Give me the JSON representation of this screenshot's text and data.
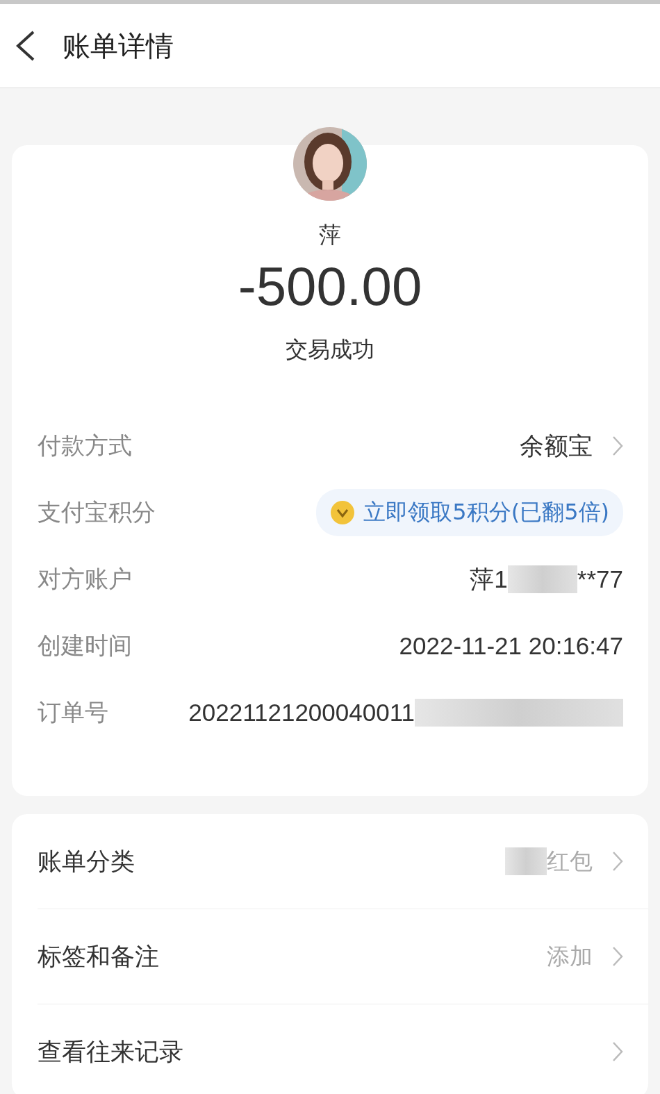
{
  "header": {
    "title": "账单详情"
  },
  "summary": {
    "name": "萍",
    "amount": "-500.00",
    "status": "交易成功"
  },
  "details": [
    {
      "kind": "link",
      "label": "付款方式",
      "value": "余额宝"
    },
    {
      "kind": "points",
      "label": "支付宝积分",
      "value": "立即领取5积分(已翻5倍)"
    },
    {
      "kind": "masked",
      "label": "对方账户",
      "value": "萍1",
      "tail": "**77"
    },
    {
      "kind": "plain",
      "label": "创建时间",
      "value": "2022-11-21 20:16:47"
    },
    {
      "kind": "masked",
      "label": "订单号",
      "value": "20221121200040011"
    }
  ],
  "actions": [
    {
      "label": "账单分类",
      "value": "红包",
      "masked": true
    },
    {
      "label": "标签和备注",
      "value": "添加",
      "masked": false
    },
    {
      "label": "查看往来记录",
      "masked": false
    }
  ]
}
